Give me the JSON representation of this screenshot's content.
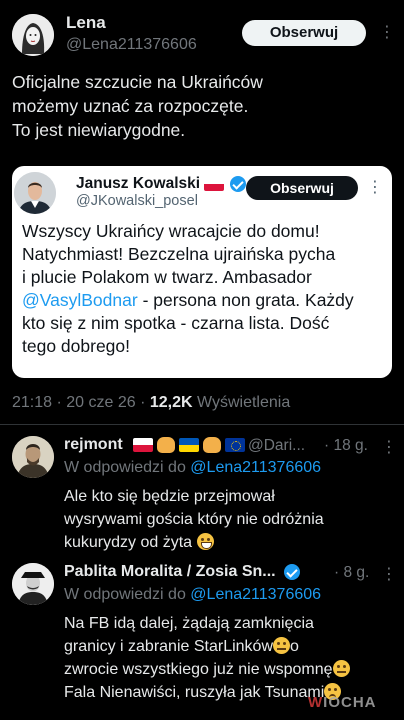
{
  "main_tweet": {
    "author_name": "Lena",
    "author_handle": "@Lena211376606",
    "follow_label": "Obserwuj",
    "text_lines": [
      "Oficjalne szczucie na Ukraińców",
      "możemy uznać za rozpoczęte.",
      "To jest niewiarygodne."
    ],
    "timestamp": "21:18 · 20 cze 26 · ",
    "views_count": "12,2K",
    "views_label": " Wyświetlenia"
  },
  "quote_tweet": {
    "author_name": "Janusz Kowalski",
    "author_handle": "@JKowalski_posel",
    "follow_label": "Obserwuj",
    "text_lines": [
      "Wszyscy Ukraińcy wracajcie do domu!",
      "Natychmiast! Bezczelna ujraińska pycha",
      "i plucie Polakom w twarz. Ambasador"
    ],
    "mention": "@VasylBodnar",
    "mention_line_rest": " - persona non grata. Każdy",
    "text_lines_after": [
      "kto się z nim spotka - czarna lista. Dość",
      "tego dobrego!"
    ]
  },
  "replies": [
    {
      "author_name": "rejmont",
      "author_handle_trunc": "@Dari...",
      "time": "· 18 g.",
      "context_prefix": "W odpowiedzi do ",
      "context_mention": "@Lena211376606",
      "text_lines": [
        "Ale kto się będzie przejmował",
        "wysrywami gościa który nie odróżnia",
        "kukurydzy od żyta"
      ]
    },
    {
      "author_name": "Pablita Moralita / Zosia Sn...",
      "time": "· 8 g.",
      "context_prefix": "W odpowiedzi do ",
      "context_mention": "@Lena211376606",
      "text_lines": [
        "Na FB idą dalej, żądają zamknięcia",
        "granicy i zabranie StarLinków",
        "o",
        "zwrocie wszystkiego już nie wspomnę",
        "Fala Nienawiści, ruszyła jak Tsunami"
      ]
    }
  ],
  "more_icon": "more-dots-icon",
  "watermark": {
    "w": "W",
    "rest": "IOCHA"
  },
  "colors": {
    "background": "#000000",
    "link": "#1d9bf0",
    "muted": "#71767b",
    "verified": "#1d9bf0"
  }
}
